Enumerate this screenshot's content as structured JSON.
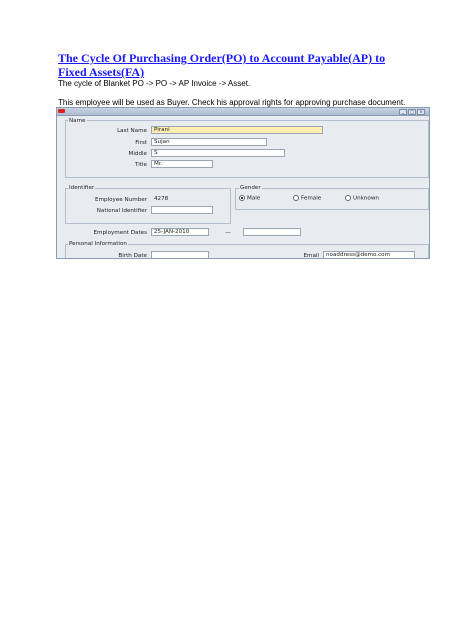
{
  "document": {
    "title": "The Cycle Of Purchasing Order(PO) to Account Payable(AP) to Fixed Assets(FA)",
    "cycle": "The cycle of Blanket PO -> PO -> AP Invoice -> Asset.",
    "note": "This employee will be used as Buyer. Check his approval rights for approving purchase document."
  },
  "form": {
    "name_group": "Name",
    "last_name_label": "Last Name",
    "last_name": "Pirani",
    "first_label": "First",
    "first": "Sujan",
    "middle_label": "Middle",
    "middle": "S",
    "title_label": "Title",
    "title": "Mr.",
    "identifier_group": "Identifier",
    "employee_number_label": "Employee Number",
    "employee_number": "4278",
    "national_id_label": "National Identifier",
    "national_id": "",
    "gender_group": "Gender",
    "gender_options": [
      "Male",
      "Female",
      "Unknown"
    ],
    "gender_selected": "Male",
    "employment_dates_label": "Employment Dates",
    "employment_start": "25-JAN-2010",
    "employment_separator": "—",
    "employment_end": "",
    "personal_group": "Personal Information",
    "birth_date_label": "Birth Date",
    "birth_date": "",
    "email_label": "Email",
    "email": "noaddress@demo.com"
  }
}
